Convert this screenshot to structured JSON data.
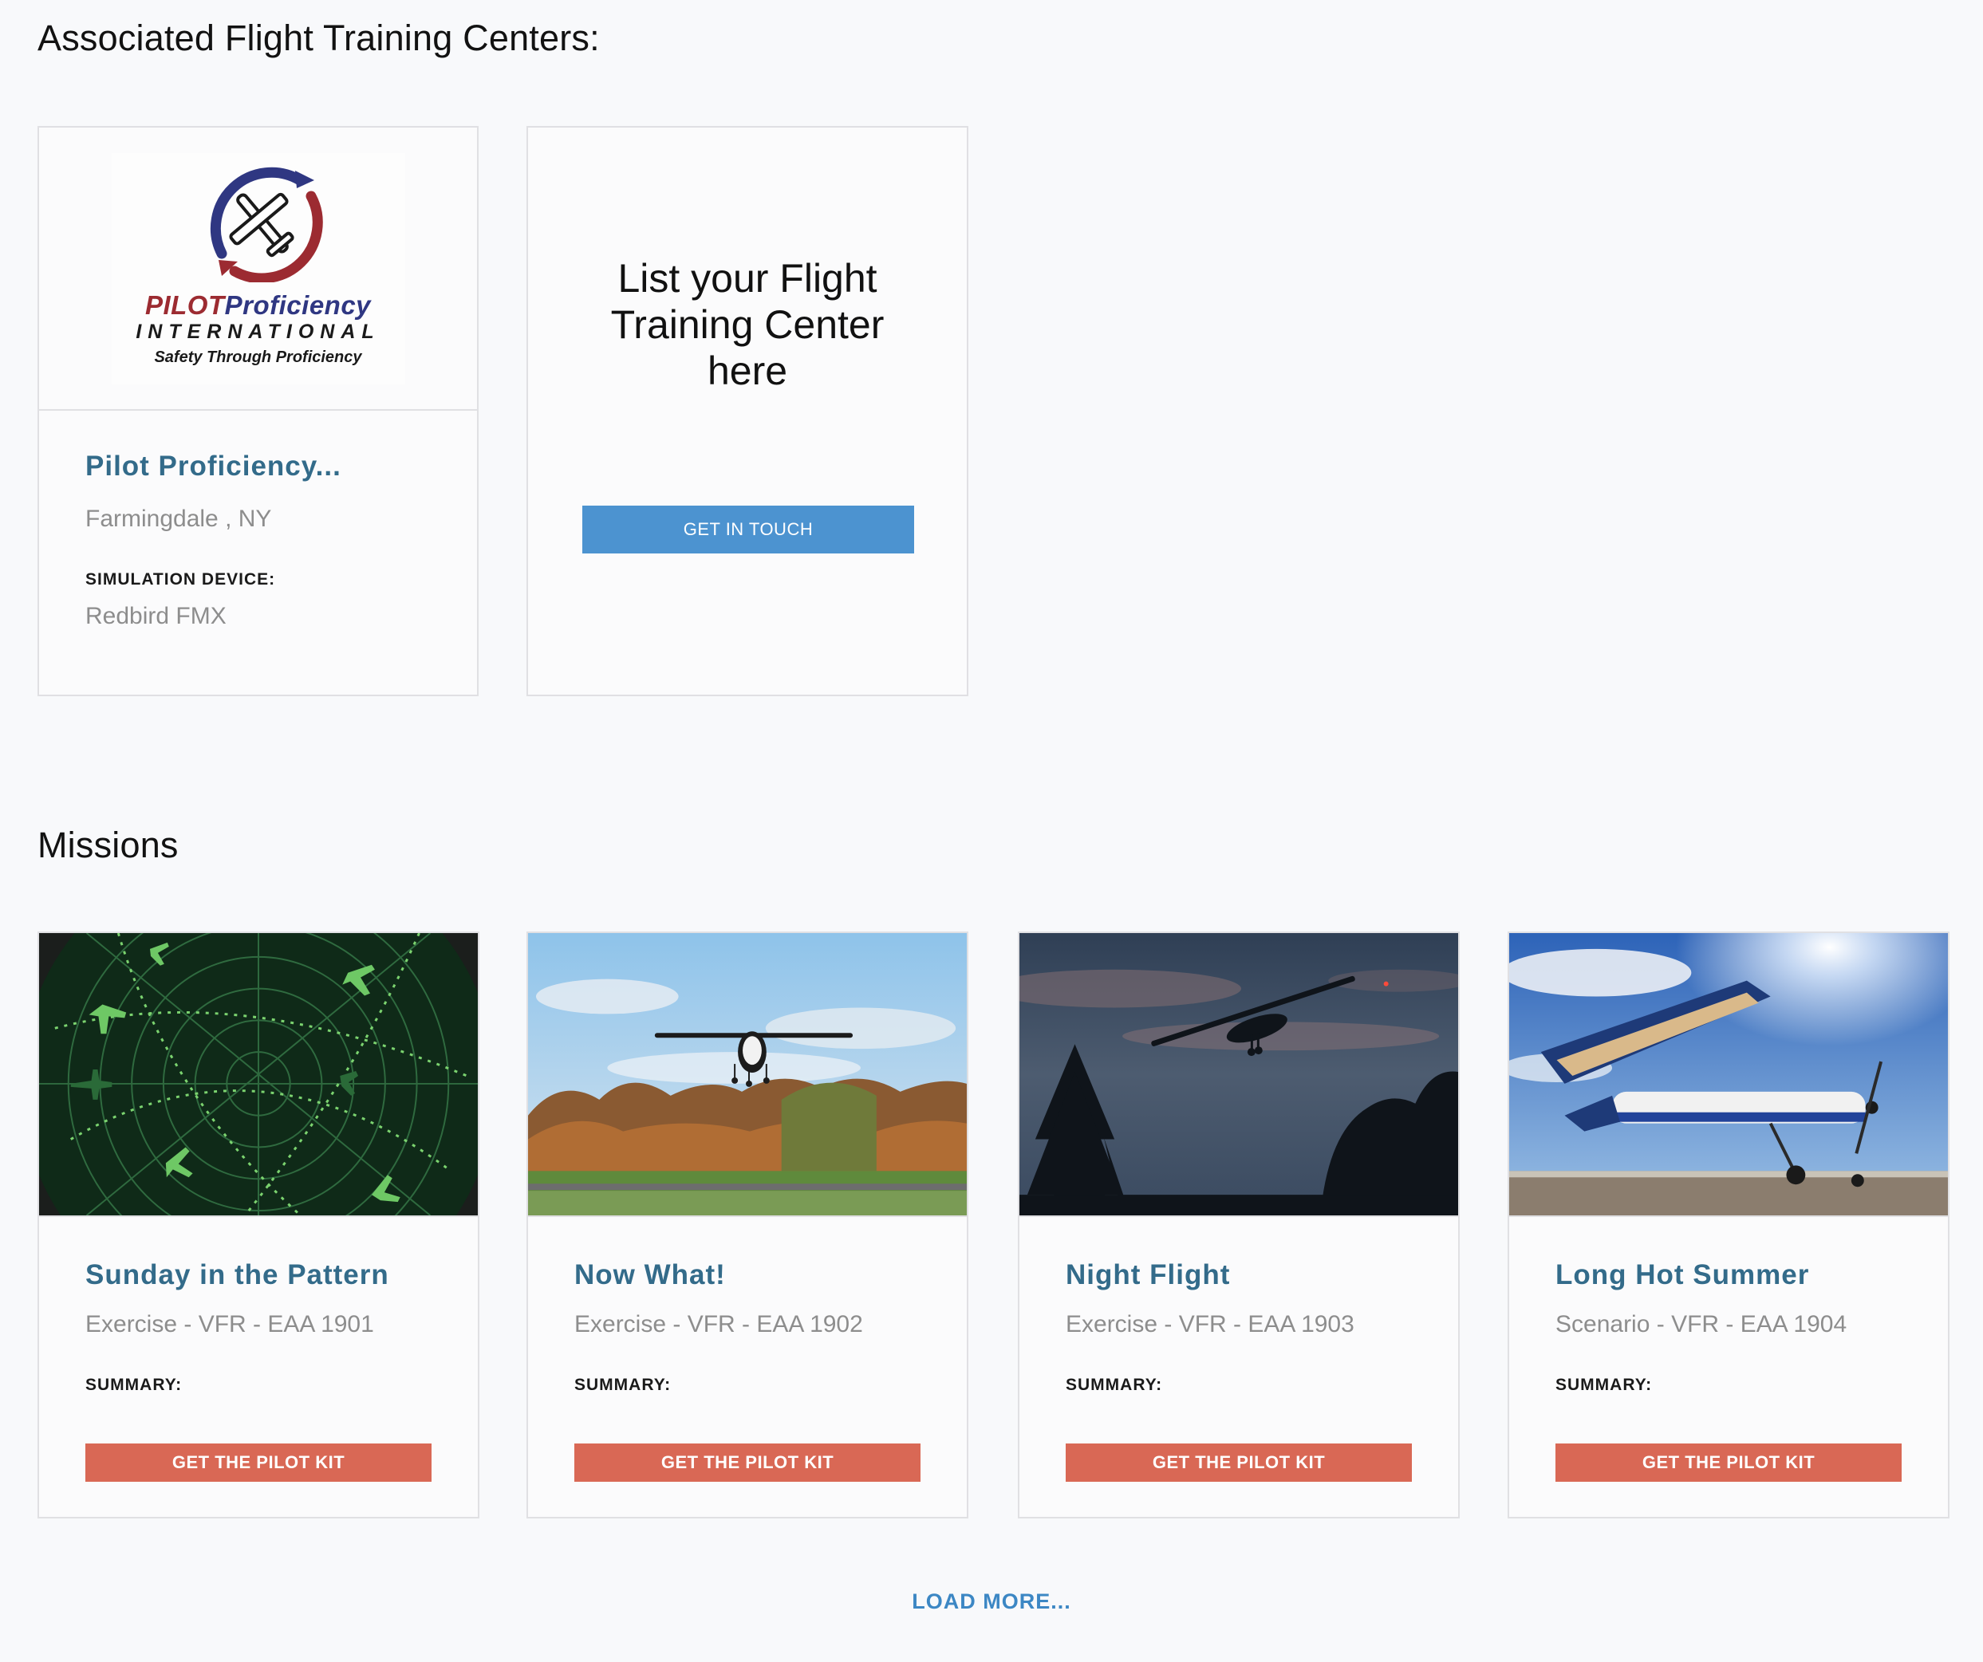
{
  "sections": {
    "ftc_title": "Associated Flight Training Centers:",
    "missions_title": "Missions"
  },
  "ftc_cards": [
    {
      "logo": {
        "brand_red": "PILOT",
        "brand_blue": "Proficiency",
        "line2": "INTERNATIONAL",
        "line3": "Safety Through Proficiency",
        "icon": "airplane-circle-icon"
      },
      "name": "Pilot Proficiency...",
      "location": "Farmingdale , NY",
      "device_label": "SIMULATION DEVICE:",
      "device": "Redbird FMX"
    }
  ],
  "cta_card": {
    "heading_line1": "List your Flight",
    "heading_line2": "Training Center",
    "heading_line3": "here",
    "button": "GET IN TOUCH"
  },
  "missions": [
    {
      "title": "Sunday in the Pattern",
      "subtitle": "Exercise - VFR - EAA 1901",
      "summary_label": "SUMMARY:",
      "button": "GET THE PILOT KIT",
      "image": "radar-screen-image"
    },
    {
      "title": "Now What!",
      "subtitle": "Exercise - VFR - EAA 1902",
      "summary_label": "SUMMARY:",
      "button": "GET THE PILOT KIT",
      "image": "plane-landing-autumn-image"
    },
    {
      "title": "Night Flight",
      "subtitle": "Exercise - VFR - EAA 1903",
      "summary_label": "SUMMARY:",
      "button": "GET THE PILOT KIT",
      "image": "plane-dusk-image"
    },
    {
      "title": "Long Hot Summer",
      "subtitle": "Scenario - VFR - EAA 1904",
      "summary_label": "SUMMARY:",
      "button": "GET THE PILOT KIT",
      "image": "plane-sunny-ramp-image"
    }
  ],
  "load_more": "LOAD MORE...",
  "colors": {
    "accent_blue": "#4c93d0",
    "title_teal": "#336b8a",
    "button_red": "#d96855",
    "link_blue": "#3c87c4"
  }
}
